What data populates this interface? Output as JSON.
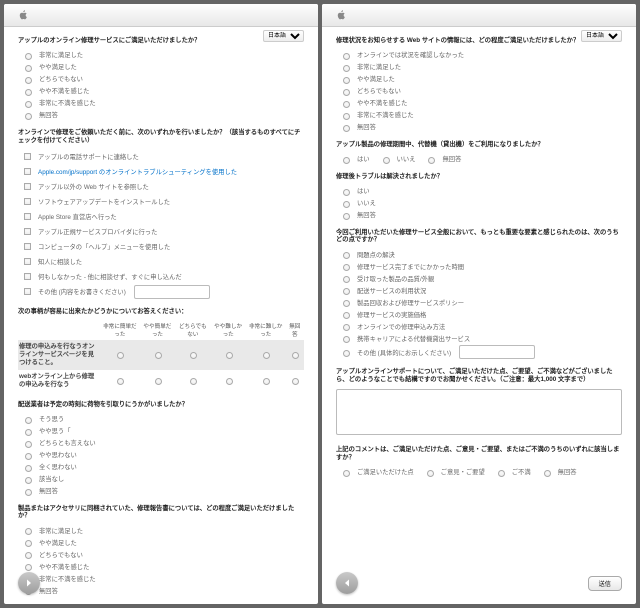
{
  "language_select": {
    "label": "日本語"
  },
  "page1": {
    "q1": {
      "title": "アップルのオンライン修理サービスにご満足いただけましたか？",
      "options": [
        "非常に満足した",
        "やや満足した",
        "どちらでもない",
        "やや不満を感じた",
        "非常に不満を感じた",
        "無回答"
      ]
    },
    "q2": {
      "title": "オンラインで修理をご依頼いただく前に、次のいずれかを行いましたか？（該当するものすべてにチェックを付けてください）",
      "options": [
        "アップルの電話サポートに連絡した",
        "Apple.com/jp/support のオンライントラブルシューティングを使用した",
        "アップル以外の Web サイトを参照した",
        "ソフトウェアアップデートをインストールした",
        "Apple Store 直営店へ行った",
        "アップル正規サービスプロバイダに行った",
        "コンピュータの「ヘルプ」メニューを使用した",
        "知人に相談した",
        "何もしなかった - 他に相談せず、すぐに申し込んだ",
        "その他 (内容をお書きください)"
      ],
      "link": "Apple.com/jp/support"
    },
    "q3": {
      "title": "次の事柄が容易に出来たかどうかについてお答えください：",
      "cols": [
        "非常に簡単だった",
        "やや簡単だった",
        "どちらでもない",
        "やや難しかった",
        "非常に難しかった",
        "無回答"
      ],
      "rows": [
        "修理の申込みを行なうオンラインサービスページを見つけること。",
        "webオンライン上から修理の申込みを行なう"
      ]
    },
    "q4": {
      "title": "配送業者は予定の時刻に荷物を引取りにうかがいましたか？",
      "options": [
        "そう思う",
        "やや思う「",
        "どちらとも言えない",
        "やや思わない",
        "全く思わない",
        "該当なし",
        "無回答"
      ]
    },
    "q5": {
      "title": "製品またはアクセサリに同梱されていた、修理報告書については、どの程度ご満足いただけましたか？",
      "options": [
        "非常に満足した",
        "やや満足した",
        "どちらでもない",
        "やや不満を感じた",
        "非常に不満を感じた",
        "無回答"
      ]
    }
  },
  "page2": {
    "q6": {
      "title": "修理状況をお知らせする Web サイトの情報には、どの程度ご満足いただけましたか？",
      "options": [
        "オンラインでは状況を確認しなかった",
        "非常に満足した",
        "やや満足した",
        "どちらでもない",
        "やや不満を感じた",
        "非常に不満を感じた",
        "無回答"
      ]
    },
    "q7": {
      "title": "アップル製品の修理期間中、代替機（貸出機）をご利用になりましたか？",
      "options": [
        "はい",
        "いいえ",
        "無回答"
      ]
    },
    "q8": {
      "title": "修理後トラブルは解決されましたか？",
      "options": [
        "はい",
        "いいえ",
        "無回答"
      ]
    },
    "q9": {
      "title": "今回ご利用いただいた修理サービス全般において、もっとも重要な要素と感じられたのは、次のうちどの点ですか？",
      "options": [
        "問題点の解決",
        "修理サービス完了までにかかった時間",
        "受け取った製品の品質/外観",
        "配送サービスの利用状況",
        "製品回収および修理サービスポリシー",
        "修理サービスの実施価格",
        "オンラインでの修理申込み方法",
        "携帯キャリアによる代替機貸出サービス",
        "その他 (具体的にお示しください)"
      ]
    },
    "q10": {
      "title": "アップルオンラインサポートについて、ご満足いただけた点、ご要望、ご不満などがございましたら、どのようなことでも結構ですのでお聞かせください。（ご注意：最大1,000 文字まで）"
    },
    "q11": {
      "title": "上記のコメントは、ご満足いただけた点、ご意見・ご要望、またはご不満のうちのいずれに該当しますか？",
      "options": [
        "ご満足いただけた点",
        "ご意見・ご要望",
        "ご不満",
        "無回答"
      ]
    },
    "submit": "送信"
  }
}
